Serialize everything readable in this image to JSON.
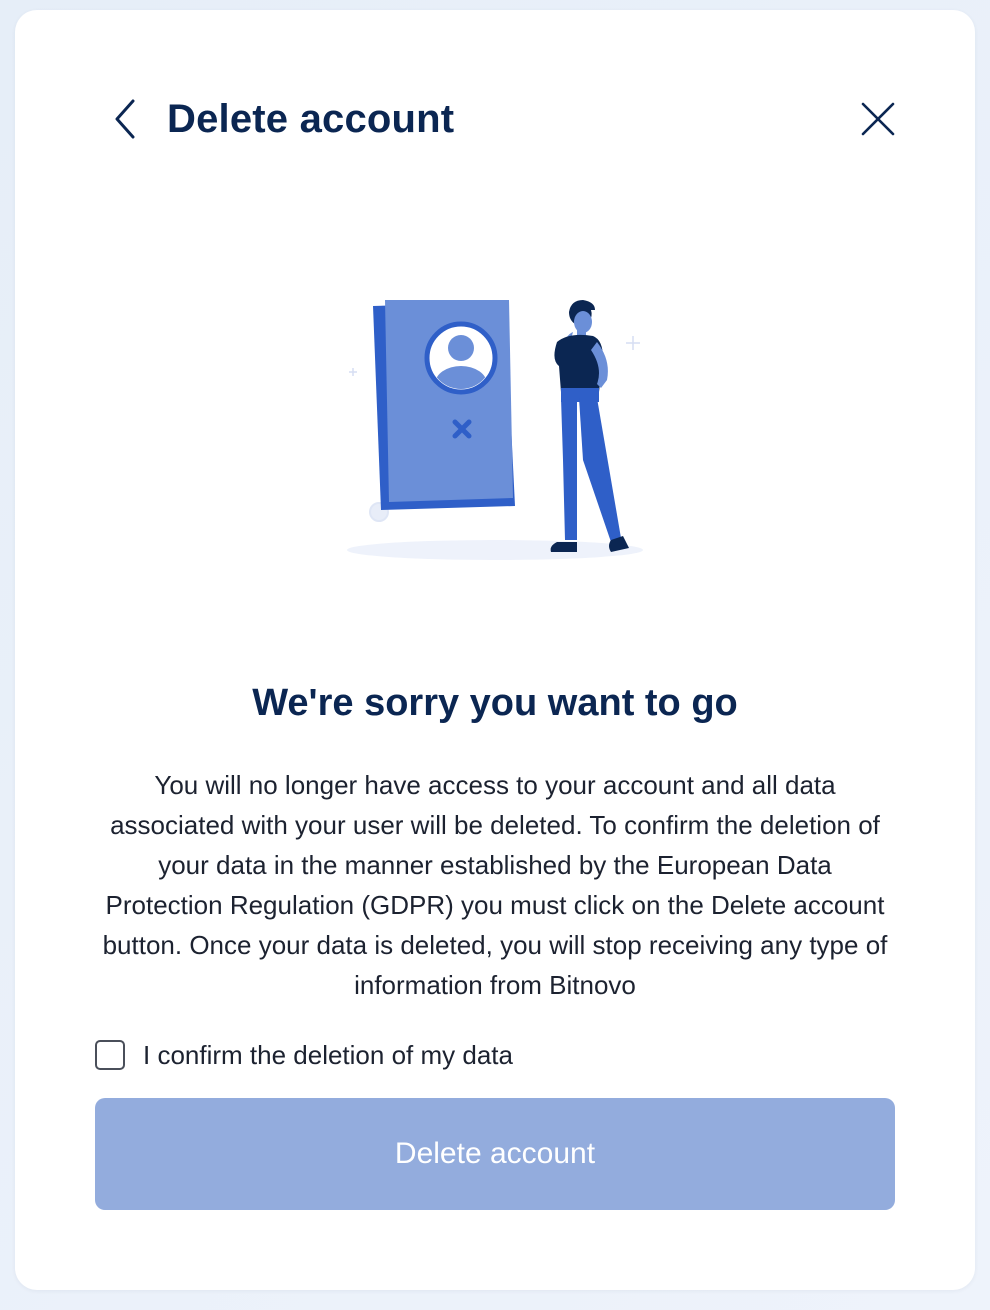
{
  "header": {
    "title": "Delete account",
    "back_icon": "chevron-left-icon",
    "close_icon": "close-icon"
  },
  "content": {
    "headline": "We're sorry you want to go",
    "description": "You will no longer have access to your account and all data associated with your user will be deleted. To confirm the deletion of your data in the manner established by the European Data Protection Regulation (GDPR) you must click on the Delete account button. Once your data is deleted, you will stop receiving any type of information from Bitnovo"
  },
  "confirm": {
    "label": "I confirm the deletion of my data",
    "checked": false
  },
  "actions": {
    "delete_label": "Delete account",
    "disabled": true
  },
  "colors": {
    "title": "#0b2652",
    "button_disabled": "#93acdd",
    "illustration_primary": "#2f5fc8",
    "illustration_panel": "#6b8fd8"
  }
}
